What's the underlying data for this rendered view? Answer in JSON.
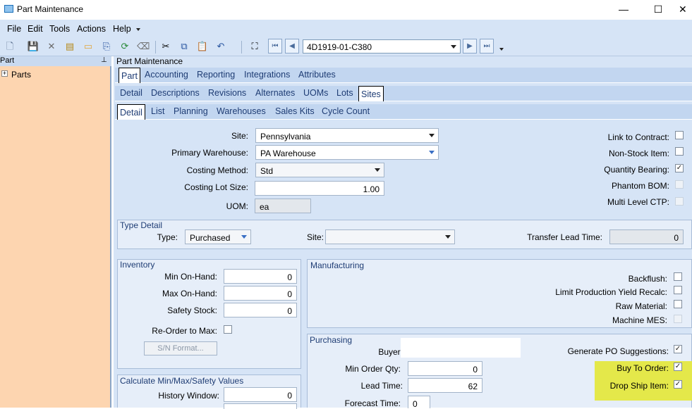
{
  "window": {
    "title": "Part Maintenance",
    "minimize": "—",
    "maximize": "☐",
    "close": "✕"
  },
  "menu": [
    "File",
    "Edit",
    "Tools",
    "Actions",
    "Help"
  ],
  "toolbar": {
    "part_number": "4D1919-01-C380"
  },
  "left_pane": {
    "header": "Part",
    "tree_root": "Parts"
  },
  "main": {
    "header": "Part Maintenance",
    "tabs_l1": [
      "Part",
      "Accounting",
      "Reporting",
      "Integrations",
      "Attributes"
    ],
    "tabs_l2": [
      "Detail",
      "Descriptions",
      "Revisions",
      "Alternates",
      "UOMs",
      "Lots",
      "Sites"
    ],
    "tabs_l3": [
      "Detail",
      "List",
      "Planning",
      "Warehouses",
      "Sales Kits",
      "Cycle Count"
    ]
  },
  "form": {
    "site_label": "Site:",
    "site_value": "Pennsylvania",
    "primary_wh_label": "Primary Warehouse:",
    "primary_wh_value": "PA Warehouse",
    "costing_method_label": "Costing Method:",
    "costing_method_value": "Std",
    "costing_lot_label": "Costing Lot Size:",
    "costing_lot_value": "1.00",
    "uom_label": "UOM:",
    "uom_value": "ea",
    "link_contract_label": "Link to Contract:",
    "non_stock_label": "Non-Stock Item:",
    "qty_bearing_label": "Quantity Bearing:",
    "phantom_label": "Phantom BOM:",
    "multi_ctp_label": "Multi Level CTP:"
  },
  "type_detail": {
    "title": "Type Detail",
    "type_label": "Type:",
    "type_value": "Purchased",
    "site_label": "Site:",
    "transfer_label": "Transfer Lead Time:",
    "transfer_value": "0"
  },
  "inventory": {
    "title": "Inventory",
    "min_label": "Min On-Hand:",
    "min_value": "0",
    "max_label": "Max On-Hand:",
    "max_value": "0",
    "safety_label": "Safety Stock:",
    "safety_value": "0",
    "reorder_label": "Re-Order to Max:",
    "sn_button": "S/N Format..."
  },
  "calc": {
    "title": "Calculate Min/Max/Safety Values",
    "history_label": "History Window:",
    "history_value": "0"
  },
  "manufacturing": {
    "title": "Manufacturing",
    "backflush_label": "Backflush:",
    "limit_label": "Limit Production Yield Recalc:",
    "raw_label": "Raw Material:",
    "mes_label": "Machine MES:"
  },
  "purchasing": {
    "title": "Purchasing",
    "buyer_label": "Buyer:",
    "min_order_label": "Min Order Qty:",
    "min_order_value": "0",
    "lead_label": "Lead Time:",
    "lead_value": "62",
    "forecast_label": "Forecast Time:",
    "forecast_value": "0",
    "gen_po_label": "Generate PO Suggestions:",
    "buy_to_order_label": "Buy To Order:",
    "drop_ship_label": "Drop Ship Item:"
  },
  "colors": {
    "accent": "#1e3c74",
    "highlight": "#e4e84a",
    "left_pane": "#fdd5b0"
  }
}
